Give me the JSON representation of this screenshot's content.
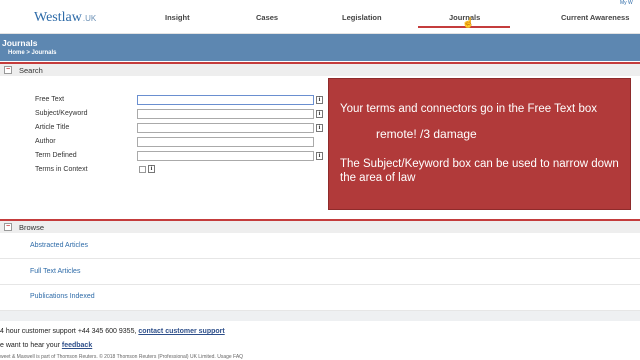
{
  "brand": {
    "name": "Westlaw",
    "suffix": ".UK"
  },
  "user_link": "My W",
  "nav": {
    "items": [
      "Insight",
      "Cases",
      "Legislation",
      "Journals",
      "Current Awareness"
    ],
    "active": "Journals"
  },
  "page": {
    "title": "Journals",
    "breadcrumb": "Home > Journals"
  },
  "search": {
    "section_label": "Search",
    "fields": [
      {
        "label": "Free Text",
        "value": ""
      },
      {
        "label": "Subject/Keyword",
        "value": ""
      },
      {
        "label": "Article Title",
        "value": ""
      },
      {
        "label": "Author",
        "value": ""
      },
      {
        "label": "Term Defined",
        "value": ""
      }
    ],
    "terms_in_context": {
      "label": "Terms in Context",
      "checked": false
    },
    "info_glyph": "i"
  },
  "overlay": {
    "line1": "Your terms and connectors go in the Free Text box",
    "line2": "remote! /3 damage",
    "line3": "The Subject/Keyword box can be used to narrow down the area of law"
  },
  "browse": {
    "section_label": "Browse",
    "links": [
      "Abstracted Articles",
      "Full Text Articles",
      "Publications Indexed"
    ]
  },
  "footer": {
    "support_text": "4 hour customer support +44 345 600 9355, ",
    "support_link": "contact customer support",
    "feedback_text": "e want to hear your ",
    "feedback_link": "feedback",
    "copyright": "weet & Maxwell is part of Thomson Reuters. © 2018 Thomson Reuters (Professional) UK Limited.   Usage FAQ"
  },
  "colors": {
    "accent_red": "#c43c3c",
    "header_blue": "#5d87b1",
    "link_blue": "#2e6ba8",
    "overlay_red": "#b13a3a"
  }
}
